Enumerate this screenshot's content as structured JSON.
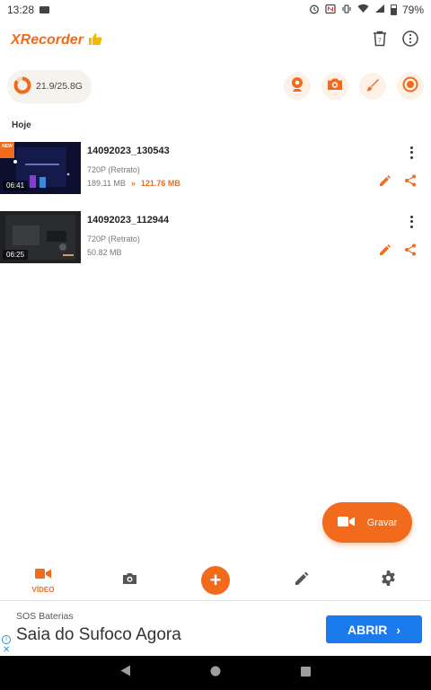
{
  "status_bar": {
    "time": "13:28",
    "battery": "79%"
  },
  "app": {
    "name": "XRecorder",
    "badge_icon": "thumbs-up-icon"
  },
  "tools": {
    "storage": "21.9/25.8G",
    "storage_used_fraction": 0.85
  },
  "section": {
    "label": "Hoje"
  },
  "videos": [
    {
      "title": "14092023_130543",
      "resolution": "720P (Retrato)",
      "size": "189.11 MB",
      "compressed_arrow": "»",
      "compressed_size": "121.76 MB",
      "duration": "06:41",
      "badge": "NEW"
    },
    {
      "title": "14092023_112944",
      "resolution": "720P (Retrato)",
      "size": "50.82 MB",
      "duration": "06:25"
    }
  ],
  "fab": {
    "label": "Gravar"
  },
  "bottom_nav": {
    "video_label": "VÍDEO",
    "add_symbol": "+"
  },
  "ad": {
    "source": "SOS Baterias",
    "headline": "Saia do Sufoco Agora",
    "cta": "ABRIR",
    "cta_arrow": "›",
    "info": "i",
    "close": "✕"
  },
  "colors": {
    "accent": "#f26b1d",
    "ad_button": "#1c7bec"
  }
}
